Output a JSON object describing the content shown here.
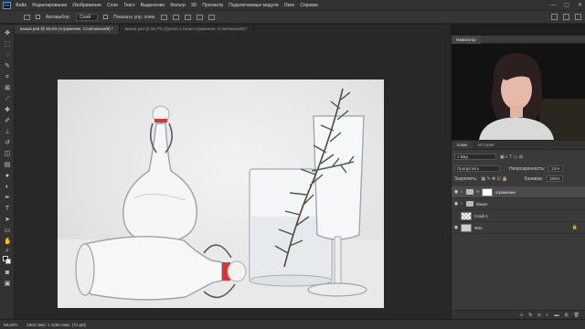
{
  "menubar": {
    "logo": "Ps",
    "items": [
      "Файл",
      "Редактирование",
      "Изображение",
      "Слои",
      "Текст",
      "Выделение",
      "Фильтр",
      "3D",
      "Просмотр",
      "Подключаемые модули",
      "Окно",
      "Справка"
    ],
    "window_controls": [
      "—",
      "▢",
      "✕"
    ]
  },
  "optionsbar": {
    "autoselect_label": "Автовыбор:",
    "autoselect_value": "Слой",
    "show_controls_label": "Показать упр. элем."
  },
  "tabs": [
    {
      "label": "вазы5.psd @ 55,6% (отражение, Слой-маска/8) *"
    },
    {
      "label": "вазы4.psd @ 66,7% (Группа 1 копия отражение, Слой-маска/8) *"
    }
  ],
  "statusbar": {
    "zoom": "55,62%",
    "doc_info": "1802 пикс. x 1256 пикс. (72 ppi)"
  },
  "navigator": {
    "title": "Навигатор"
  },
  "layers_panel": {
    "tabs": [
      "Слои",
      "История"
    ],
    "kind_filter": "Вид",
    "blend_mode": "Пропустить",
    "opacity_label": "Непрозрачность:",
    "opacity_value": "21%",
    "lock_label": "Закрепить:",
    "fill_label": "Заливка:",
    "fill_value": "100%",
    "layers": [
      {
        "name": "отражение",
        "type": "group",
        "selected": true,
        "visible": true,
        "has_mask": true
      },
      {
        "name": "бокал",
        "type": "group",
        "selected": false,
        "visible": true,
        "has_mask": false
      },
      {
        "name": "Слой 1",
        "type": "layer",
        "selected": false,
        "visible": false,
        "has_mask": false
      },
      {
        "name": "Фон",
        "type": "layer",
        "selected": false,
        "visible": true,
        "has_mask": false
      }
    ]
  },
  "colors": {
    "ps_blue": "#31a8ff",
    "panel": "#3a3a3a",
    "canvas_bg": "#282828"
  }
}
